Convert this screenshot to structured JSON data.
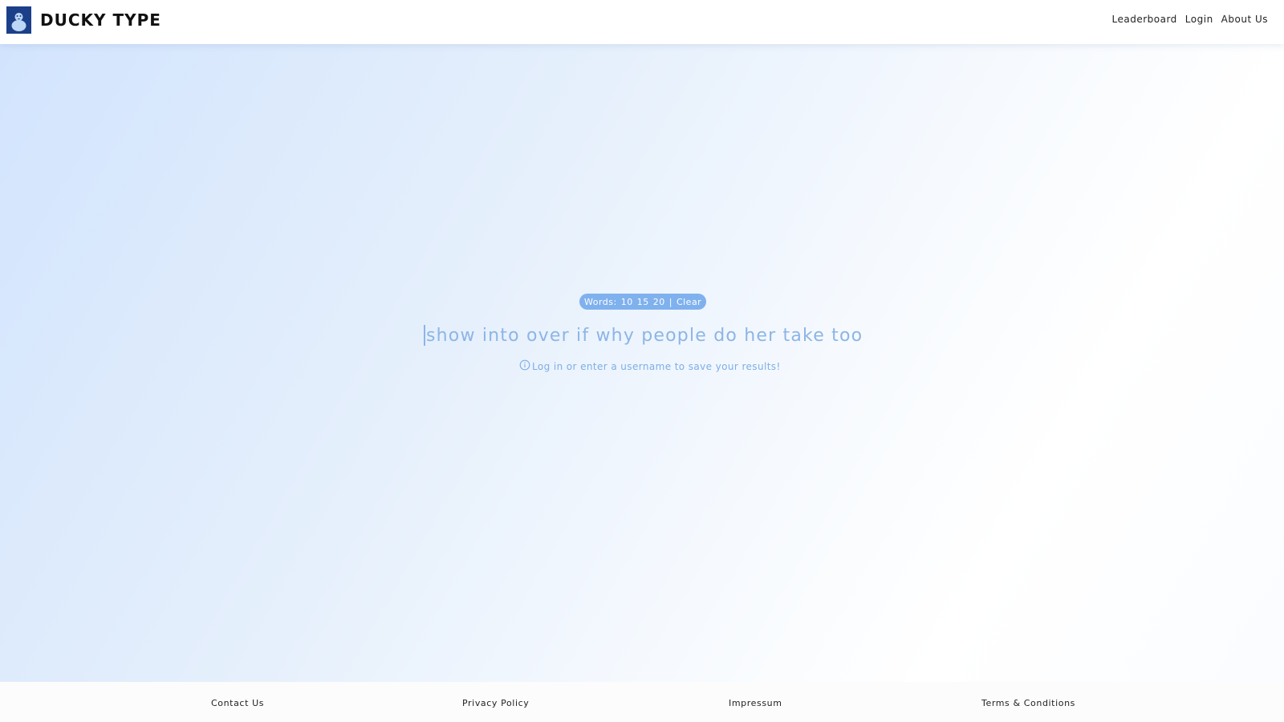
{
  "header": {
    "brand": "DUCKY TYPE",
    "nav": [
      "Leaderboard",
      "Login",
      "About Us"
    ]
  },
  "test": {
    "words_label": "Words:",
    "word_options": [
      "10",
      "15",
      "20"
    ],
    "separator": "|",
    "clear_label": "Clear",
    "text": "show into over if why people do her take too",
    "hint": "Log in or enter a username to save your results!"
  },
  "footer": {
    "links": [
      "Contact Us",
      "Privacy Policy",
      "Impressum",
      "Terms & Conditions"
    ]
  },
  "colors": {
    "brand": "#1c3f8a",
    "accent": "#7fb1ee",
    "text_muted": "#8cb5e6"
  },
  "icons": {
    "logo": "duck-logo-icon",
    "hint": "info-icon"
  }
}
